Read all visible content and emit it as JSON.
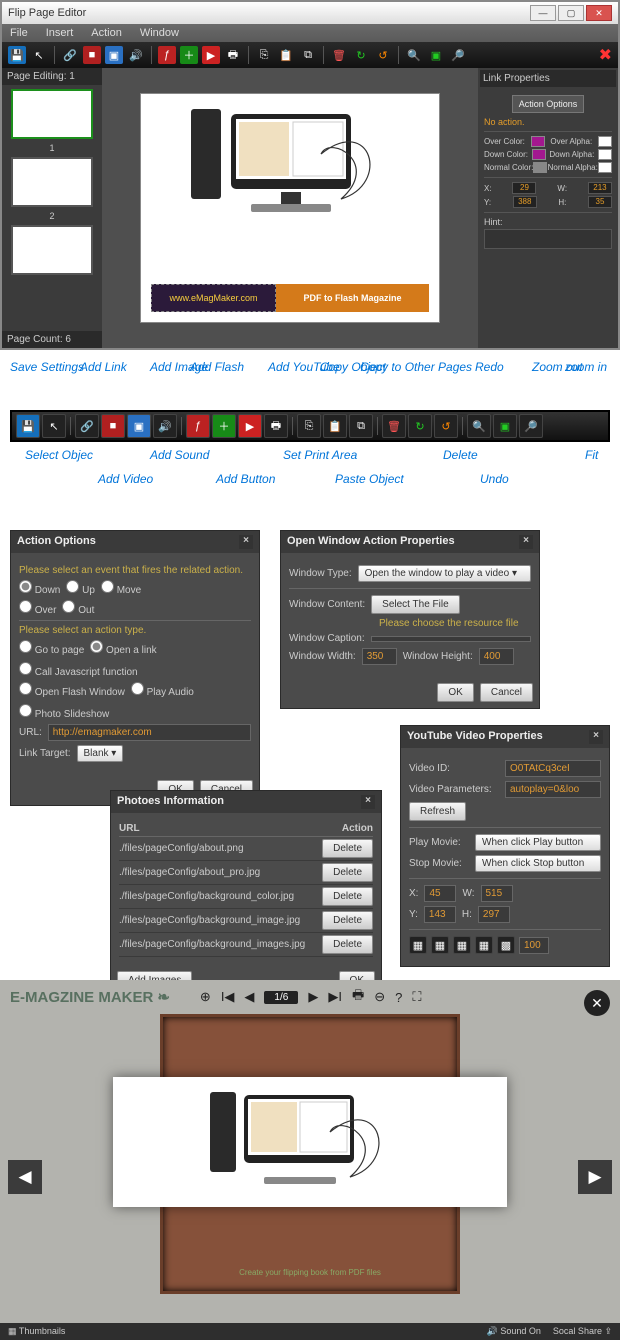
{
  "editor": {
    "title": "Flip Page Editor",
    "menu": [
      "File",
      "Insert",
      "Action",
      "Window"
    ],
    "page_editing_label": "Page Editing: 1",
    "page_count_label": "Page Count: 6",
    "thumb_nums": [
      "1",
      "2"
    ],
    "banner_left": "www.eMagMaker.com",
    "banner_right": "PDF to Flash Magazine",
    "link_props": {
      "title": "Link Properties",
      "action_options_btn": "Action Options",
      "no_action": "No action.",
      "over_color": "Over Color:",
      "down_color": "Down Color:",
      "normal_color": "Normal Color:",
      "over_alpha": "Over Alpha:",
      "down_alpha": "Down Alpha:",
      "normal_alpha": "Normal Alpha:",
      "x_lbl": "X:",
      "x_val": "29",
      "w_lbl": "W:",
      "w_val": "213",
      "y_lbl": "Y:",
      "y_val": "388",
      "h_lbl": "H:",
      "h_val": "35",
      "hint": "Hint:"
    }
  },
  "toolbar_labels": {
    "top": [
      "Save Settings",
      "Add Image",
      "Add YouTube",
      "Copy to Other Pages",
      "Zoom out"
    ],
    "upper": [
      "Add Link",
      "Add Flash",
      "Copy Object",
      "Redo",
      "zoom in"
    ],
    "lower": [
      "Select Objec",
      "Add Sound",
      "Set Print Area",
      "Delete",
      "Fit"
    ],
    "bottom": [
      "Add Video",
      "Add Button",
      "Paste Object",
      "Undo"
    ]
  },
  "dlg_action": {
    "title": "Action Options",
    "hint1": "Please select an event that fires the related action.",
    "r1": [
      "Down",
      "Up",
      "Move"
    ],
    "r2": [
      "Over",
      "Out"
    ],
    "hint2": "Please select an action type.",
    "r3": [
      "Go to page",
      "Open a link",
      "Call Javascript function"
    ],
    "r4": [
      "Open Flash Window",
      "Play Audio",
      "Photo Slideshow"
    ],
    "url_lbl": "URL:",
    "url_val": "http://emagmaker.com",
    "target_lbl": "Link Target:",
    "target_val": "Blank",
    "ok": "OK",
    "cancel": "Cancel"
  },
  "dlg_openwin": {
    "title": "Open Window Action Properties",
    "wtype_lbl": "Window Type:",
    "wtype_val": "Open the window to play a video",
    "wcontent_lbl": "Window Content:",
    "select_file": "Select The File",
    "choose": "Please choose the resource file",
    "wcap_lbl": "Window Caption:",
    "ww_lbl": "Window Width:",
    "ww_val": "350",
    "wh_lbl": "Window Height:",
    "wh_val": "400",
    "ok": "OK",
    "cancel": "Cancel"
  },
  "dlg_youtube": {
    "title": "YouTube Video Properties",
    "vid_lbl": "Video ID:",
    "vid_val": "O0TAtCq3ceI",
    "vp_lbl": "Video Parameters:",
    "vp_val": "autoplay=0&loo",
    "refresh": "Refresh",
    "play_lbl": "Play Movie:",
    "play_val": "When click Play button",
    "stop_lbl": "Stop Movie:",
    "stop_val": "When click Stop button",
    "x": "45",
    "w": "515",
    "y": "143",
    "h": "297",
    "op": "100",
    "xl": "X:",
    "wl": "W:",
    "yl": "Y:",
    "hl": "H:"
  },
  "dlg_photos": {
    "title": "Photoes Information",
    "col_url": "URL",
    "col_act": "Action",
    "rows": [
      "./files/pageConfig/about.png",
      "./files/pageConfig/about_pro.jpg",
      "./files/pageConfig/background_color.jpg",
      "./files/pageConfig/background_image.jpg",
      "./files/pageConfig/background_images.jpg"
    ],
    "delete": "Delete",
    "add": "Add Images",
    "ok": "OK"
  },
  "viewer": {
    "brand": "E-MAGZINE MAKER",
    "page": "1/6",
    "caption": "Create your flipping book from PDF files",
    "thumbs": "Thumbnails",
    "sound": "Sound On",
    "share": "Socal Share"
  }
}
